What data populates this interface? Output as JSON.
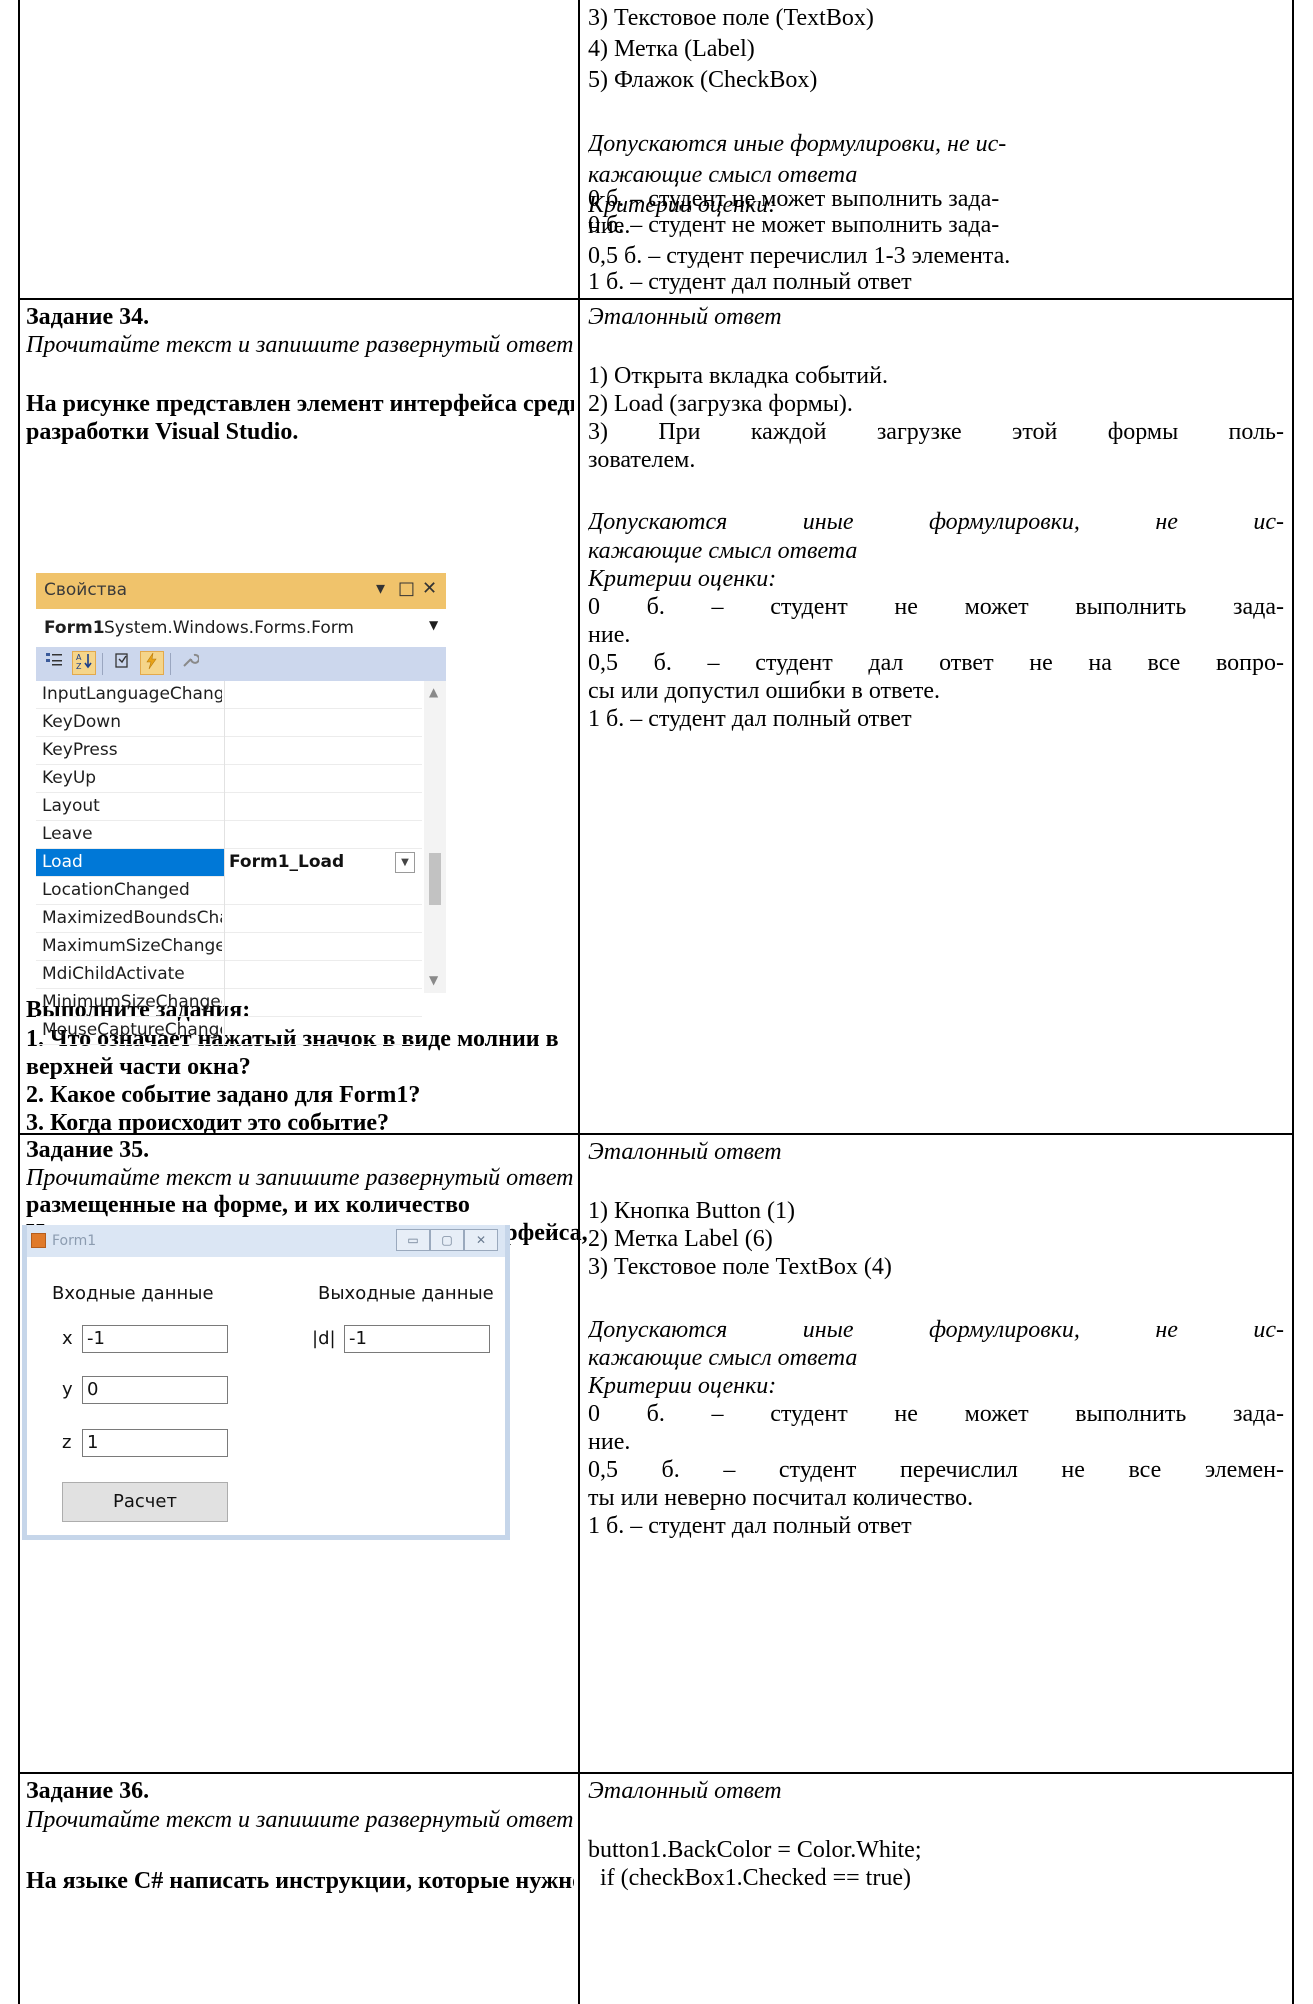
{
  "top_answer": {
    "list": [
      "3) Текстовое поле (TextBox)",
      "4) Метка (Label)",
      "5) Флажок (CheckBox)"
    ],
    "note_lines": [
      "Допускаются иные формулировки, не ис-",
      "кажающие смысл ответа"
    ],
    "criteria_title": "Критерии оценки:",
    "criteria_lines": [
      "0 б. – студент не может выполнить зада-",
      "ние.",
      "0,5 б. – студент перечислил 1-3 элемента.",
      "1 б. – студент дал полный ответ"
    ]
  },
  "task34": {
    "title": "Задание 34.",
    "instruction": "Прочитайте текст и запишите развернутый ответ",
    "prompt_lines": [
      "На рисунке представлен элемент интерфейса среды",
      "разработки Visual Studio."
    ],
    "panel": {
      "title": "Свойства",
      "title_controls": [
        "▾",
        "□",
        "✕"
      ],
      "object_name": "Form1",
      "object_type": "System.Windows.Forms.Form",
      "dropdown_icon": "chevron-down-icon",
      "toolbar_icons": [
        "categorized-icon",
        "alphabetical-icon",
        "properties-icon",
        "events-lightning-icon",
        "property-pages-wrench-icon"
      ],
      "events": [
        {
          "name": "InputLanguageChangi",
          "value": ""
        },
        {
          "name": "KeyDown",
          "value": ""
        },
        {
          "name": "KeyPress",
          "value": ""
        },
        {
          "name": "KeyUp",
          "value": ""
        },
        {
          "name": "Layout",
          "value": ""
        },
        {
          "name": "Leave",
          "value": ""
        },
        {
          "name": "Load",
          "value": "Form1_Load"
        },
        {
          "name": "LocationChanged",
          "value": ""
        },
        {
          "name": "MaximizedBoundsCha",
          "value": ""
        },
        {
          "name": "MaximumSizeChanged",
          "value": ""
        },
        {
          "name": "MdiChildActivate",
          "value": ""
        },
        {
          "name": "MinimumSizeChanged",
          "value": ""
        },
        {
          "name": "MouseCaptureChange",
          "value": ""
        }
      ],
      "selected_event": "Load",
      "colors": {
        "title_bar": "#f0c36b",
        "toolbar": "#ccd7ed",
        "selection": "#0078d7"
      }
    },
    "questions_title": "Выполните задания:",
    "questions": [
      "1. Что означает нажатый значок в виде молнии в",
      "верхней части окна?",
      "2. Какое событие задано для Form1?",
      "3. Когда происходит это событие?"
    ],
    "answer_title": "Эталонный ответ",
    "answer_lines": [
      "1) Открыта вкладка событий.",
      "2) Load (загрузка формы).",
      "3) При каждой загрузке этой формы поль-",
      "зователем."
    ],
    "note_lines": [
      "Допускаются иные формулировки, не ис-",
      "кажающие смысл ответа"
    ],
    "criteria_title": "Критерии оценки:",
    "criteria_lines": [
      "0 б. – студент не может выполнить зада-",
      "ние.",
      "0,5 б. – студент дал ответ не на все вопро-",
      "сы или допустил ошибки в ответе.",
      "1 б. – студент дал полный ответ"
    ]
  },
  "task35": {
    "title": "Задание 35.",
    "instruction": "Прочитайте текст и запишите развернутый ответ",
    "prompt_lines": [
      "Назовите элементы пользовательского интерфейса,",
      "размещенные на форме, и их количество"
    ],
    "form": {
      "title": "Form1",
      "window_buttons": [
        "▭",
        "▢",
        "✕"
      ],
      "input_header": "Входные данные",
      "output_header": "Выходные данные",
      "x_label": "x",
      "x_value": "-1",
      "y_label": "y",
      "y_value": "0",
      "z_label": "z",
      "z_value": "1",
      "d_label": "|d|",
      "d_value": "-1",
      "button_label": "Расчет"
    },
    "answer_title": "Эталонный ответ",
    "answer_lines": [
      "1) Кнопка Button (1)",
      "2) Метка Label (6)",
      "3) Текстовое поле TextBox (4)"
    ],
    "note_lines": [
      "Допускаются иные формулировки, не ис-",
      "кажающие смысл ответа"
    ],
    "criteria_title": "Критерии оценки:",
    "criteria_lines": [
      "0 б. – студент не может выполнить зада-",
      "ние.",
      "0,5 б. – студент перечислил не все элемен-",
      "ты или неверно посчитал количество.",
      "1 б. – студент дал полный ответ"
    ]
  },
  "task36": {
    "title": "Задание 36.",
    "instruction": "Прочитайте текст и запишите развернутый ответ",
    "prompt_partial": "На языке C# написать инструкции, которые нужно",
    "answer_title": "Эталонный ответ",
    "code_lines": [
      "button1.BackColor = Color.White;",
      "  if (checkBox1.Checked == true)"
    ]
  }
}
